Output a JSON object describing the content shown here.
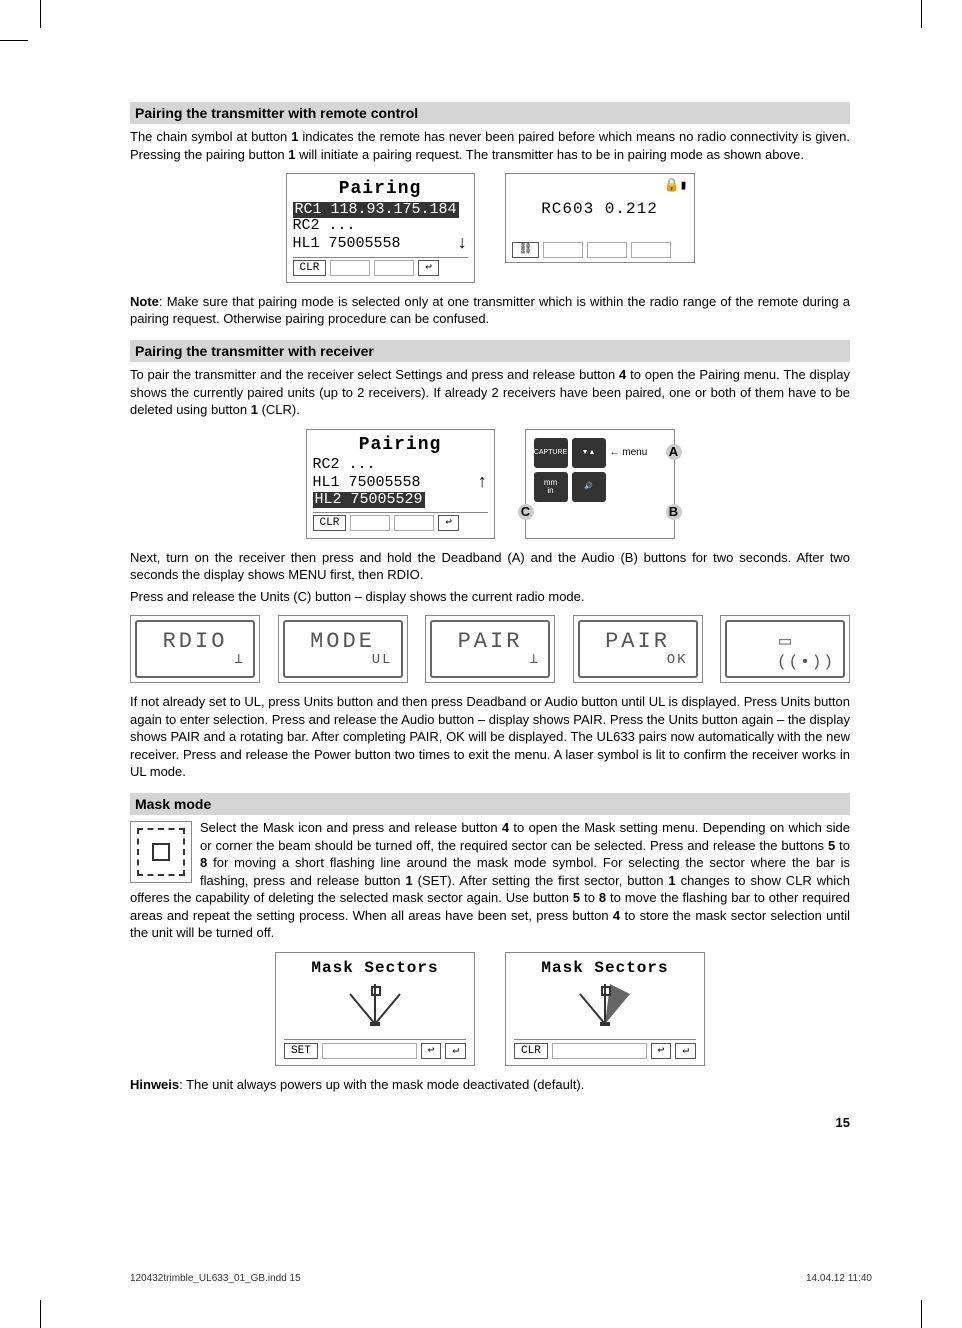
{
  "section1": {
    "title": "Pairing the transmitter with remote control",
    "p1a": "The chain symbol at button ",
    "b1": "1",
    "p1b": " indicates the remote has never been paired before which means no radio connectivity is given. Pressing the pairing button ",
    "b2": "1",
    "p1c": " will initiate a pairing request. The transmitter has to be in pairing mode as shown above.",
    "lcd1": {
      "title": "Pairing",
      "line1": "RC1 118.93.175.184",
      "line2": "RC2 ...",
      "line3": "HL1 75005558",
      "btn": "CLR"
    },
    "lcd2": {
      "text": "RC603 0.212"
    },
    "note_b": "Note",
    "note": ": Make sure that pairing mode is selected only at one transmitter which is within the radio range of the remote during a pairing request. Otherwise pairing procedure can be confused."
  },
  "section2": {
    "title": "Pairing the transmitter with receiver",
    "p1a": "To pair the transmitter and the receiver select Settings and press and release button ",
    "b1": "4",
    "p1b": " to open the Pairing menu. The display shows the currently paired units (up to 2 receivers). If already 2 receivers have been paired, one or both of them have to be deleted using button ",
    "b2": "1",
    "p1c": " (CLR).",
    "lcd": {
      "title": "Pairing",
      "line1": "RC2 ...",
      "line2": "HL1 75005558",
      "line3": "HL2 75005529",
      "btn": "CLR"
    },
    "keys": {
      "capture": "CAPTURE",
      "mm": "mm",
      "in": "in",
      "labelA": "A",
      "labelB": "B",
      "labelC": "C",
      "menu": "menu"
    },
    "p2": "Next, turn on the receiver then press and hold the Deadband (A) and the Audio (B) buttons for two seconds. After two seconds the display shows MENU first, then RDIO.",
    "p3": "Press and release the Units (C) button – display shows the current radio mode.",
    "segs": {
      "s1": "RDIO",
      "s2a": "MODE",
      "s2b": "UL",
      "s3": "PAIR",
      "s4a": "PAIR",
      "s4b": "OK",
      "s5icon": "📄",
      "s5radio": "((📶))"
    },
    "p4": "If not already set to UL, press Units button and then press Deadband or Audio button until UL is displayed. Press Units button again to enter selection. Press and release the Audio button – display shows PAIR. Press the Units button again – the display shows PAIR and a rotating bar. After completing PAIR, OK will be displayed. The UL633 pairs now automatically with the new receiver. Press and release the Power button two times to exit the menu. A laser symbol is lit to confirm the receiver works in UL mode."
  },
  "section3": {
    "title": "Mask mode",
    "p1a": "Select the Mask icon and press and release button ",
    "b1": "4",
    "p1b": " to open the Mask setting menu. Depending on which side or corner the beam should be turned off, the required sector can be selected. Press and release the buttons ",
    "b2": "5",
    "p1c": " to ",
    "b3": "8",
    "p1d": " for moving a short flashing line around the mask mode symbol. For selecting the sector where the bar is flashing, press and release button ",
    "b4": "1",
    "p1e": " (SET). After setting the first sector, button ",
    "b5": "1",
    "p1f": " changes to show CLR which offeres the capability of deleting the selected mask sector again. Use button ",
    "b6": "5",
    "p1g": " to ",
    "b7": "8",
    "p1h": " to move the flashing bar to other required areas and repeat the setting process. When all areas have been set, press button ",
    "b8": "4",
    "p1i": " to store the mask sector selection until the unit will be turned off.",
    "lcd1": {
      "title": "Mask Sectors",
      "btn": "SET"
    },
    "lcd2": {
      "title": "Mask Sectors",
      "btn": "CLR"
    },
    "hinweis_b": "Hinweis",
    "hinweis": ": The unit always powers up with the mask mode deactivated (default)."
  },
  "pageNum": "15",
  "footer": {
    "left": "120432trimble_UL633_01_GB.indd   15",
    "right": "14.04.12   11:40"
  }
}
